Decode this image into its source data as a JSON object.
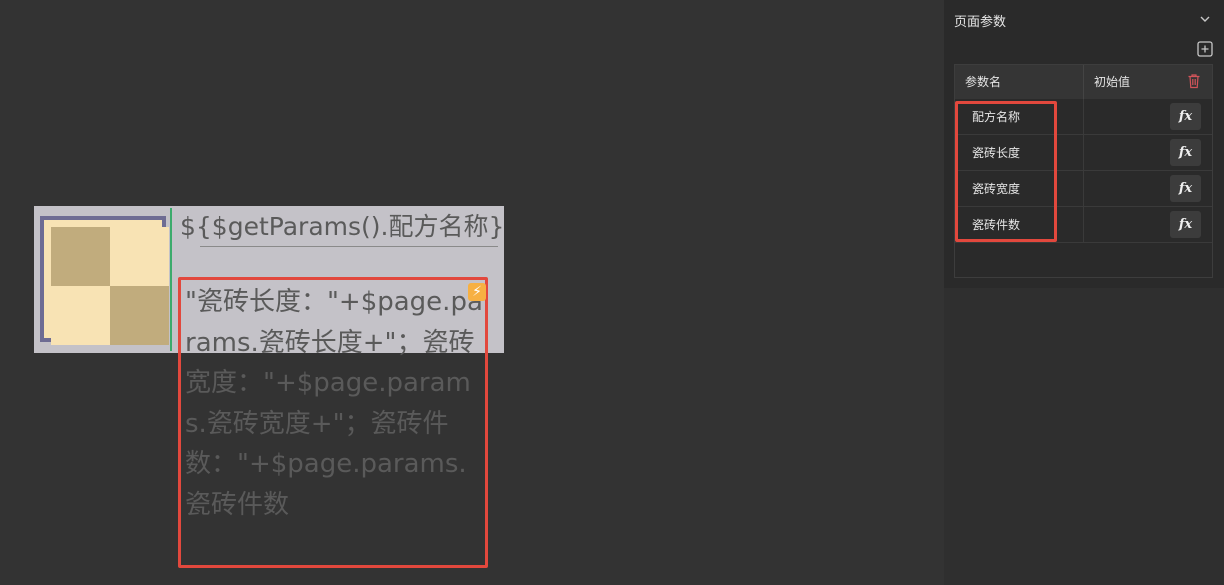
{
  "canvas": {
    "title_expression": "${$getParams().配方名称}",
    "value_expression": "\"瓷砖长度：\"+$page.params.瓷砖长度+\"；瓷砖宽度：\"+$page.params.瓷砖宽度+\"；瓷砖件数：\"+$page.params.瓷砖件数",
    "lightning_icon": "lightning-icon"
  },
  "panel": {
    "title": "页面参数",
    "table": {
      "headers": [
        "参数名",
        "初始值"
      ],
      "rows": [
        {
          "name": "配方名称",
          "value": "",
          "fx": "fx"
        },
        {
          "name": "瓷砖长度",
          "value": "",
          "fx": "fx"
        },
        {
          "name": "瓷砖宽度",
          "value": "",
          "fx": "fx"
        },
        {
          "name": "瓷砖件数",
          "value": "",
          "fx": "fx"
        }
      ]
    }
  },
  "colors": {
    "highlight": "#e2483d",
    "tile_dark": "#c1ac7d",
    "tile_light": "#f8e3b4",
    "tile_border": "#6e6c93",
    "accent_green": "#3cab6c"
  }
}
